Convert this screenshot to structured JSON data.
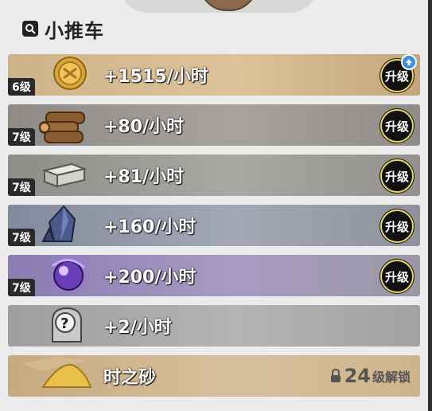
{
  "header": {
    "title": "小推车"
  },
  "rows": [
    {
      "level": "6级",
      "rate": "+1515/小时",
      "resource_icon": "gold-coin-icon",
      "upgrade_label": "升级",
      "upgrade_available": true,
      "bg": "#c9ac7f"
    },
    {
      "level": "7级",
      "rate": "+80/小时",
      "resource_icon": "wood-logs-icon",
      "upgrade_label": "升级",
      "bg": "#9a9792"
    },
    {
      "level": "7级",
      "rate": "+81/小时",
      "resource_icon": "stone-blocks-icon",
      "upgrade_label": "升级",
      "bg": "#9c9a97"
    },
    {
      "level": "7级",
      "rate": "+160/小时",
      "resource_icon": "crystal-ore-icon",
      "upgrade_label": "升级",
      "bg": "#8f96a7"
    },
    {
      "level": "7级",
      "rate": "+200/小时",
      "resource_icon": "magic-orb-icon",
      "upgrade_label": "升级",
      "bg": "#9588b2"
    },
    {
      "rate": "+2/小时",
      "resource_icon": "mystery-helmet-icon",
      "bg": "#a6a6a6"
    },
    {
      "name": "时之砂",
      "resource_icon": "sand-pile-icon",
      "lock_icon": "lock-icon",
      "unlock_level": "24",
      "unlock_text": "级解锁",
      "bg": "#c8ae85"
    }
  ],
  "colors": {
    "accent_ring": "#e8d760",
    "upgrade_badge": "#3a8fe0"
  }
}
